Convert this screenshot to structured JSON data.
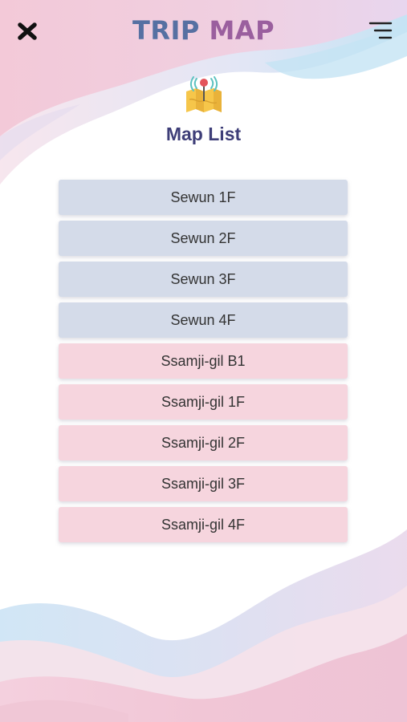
{
  "topbar": {
    "title_part1": "TRIP",
    "title_part2": "MAP",
    "close_icon": "close-icon",
    "menu_icon": "menu-icon"
  },
  "header": {
    "icon": "map-pin-icon",
    "title": "Map List"
  },
  "maps": [
    {
      "label": "Sewun 1F",
      "group": "sewun"
    },
    {
      "label": "Sewun 2F",
      "group": "sewun"
    },
    {
      "label": "Sewun 3F",
      "group": "sewun"
    },
    {
      "label": "Sewun 4F",
      "group": "sewun"
    },
    {
      "label": "Ssamji-gil B1",
      "group": "ssamji"
    },
    {
      "label": "Ssamji-gil 1F",
      "group": "ssamji"
    },
    {
      "label": "Ssamji-gil 2F",
      "group": "ssamji"
    },
    {
      "label": "Ssamji-gil 3F",
      "group": "ssamji"
    },
    {
      "label": "Ssamji-gil 4F",
      "group": "ssamji"
    }
  ],
  "colors": {
    "sewun_item": "#d4dbe9",
    "ssamji_item": "#f6d5de",
    "title_blue": "#5670a2",
    "title_purple": "#9a5f9e",
    "heading": "#3e3e78"
  }
}
